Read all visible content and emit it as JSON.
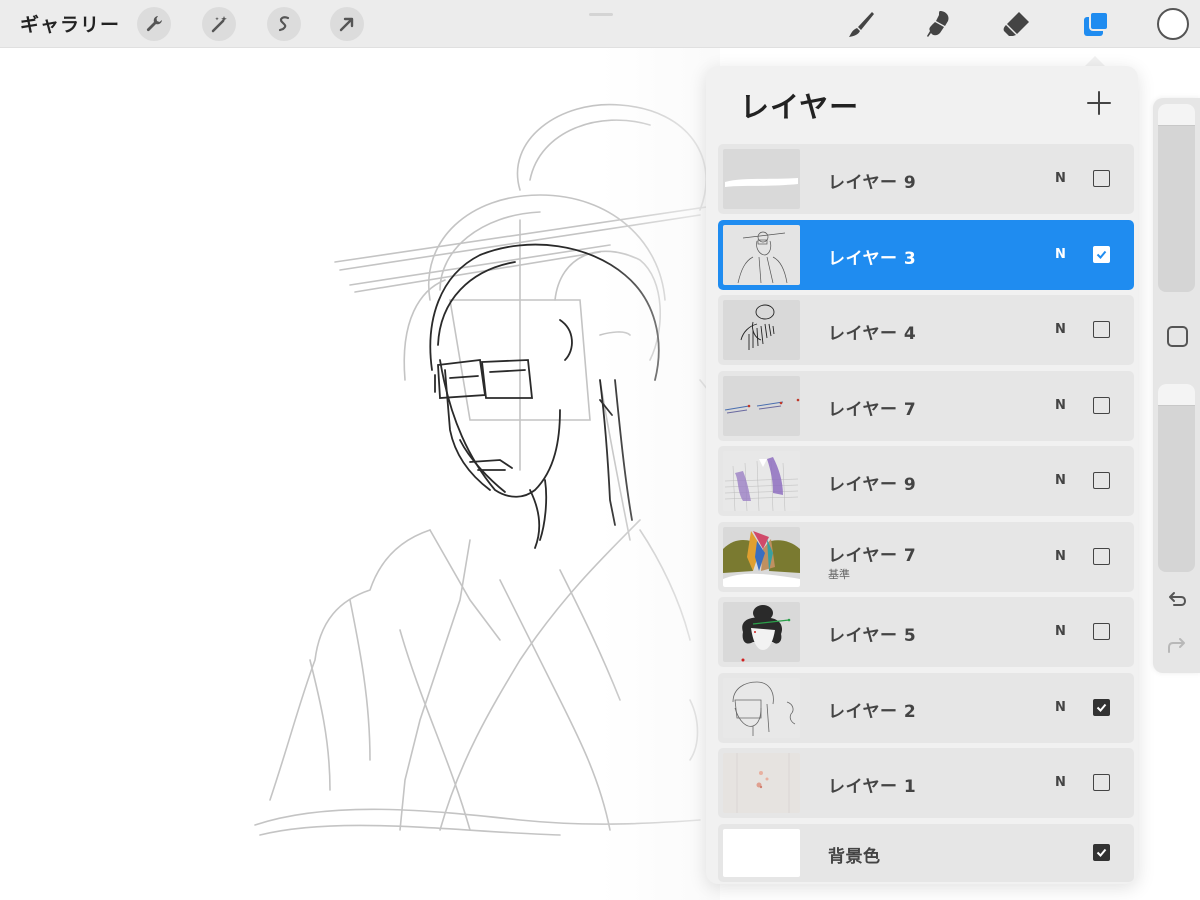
{
  "toolbar": {
    "gallery_label": "ギャラリー",
    "left_tools": [
      {
        "icon": "wrench-icon"
      },
      {
        "icon": "magic-wand-icon"
      },
      {
        "icon": "selection-icon"
      },
      {
        "icon": "transform-arrow-icon"
      }
    ],
    "right_tools": [
      {
        "icon": "brush-icon"
      },
      {
        "icon": "smudge-icon"
      },
      {
        "icon": "eraser-icon"
      },
      {
        "icon": "layers-icon",
        "active": true
      }
    ],
    "color_swatch": "#ffffff",
    "accent": "#1f8cf0"
  },
  "layers_panel": {
    "title": "レイヤー",
    "add_icon": "plus-icon",
    "layers": [
      {
        "name": "レイヤー 9",
        "blend": "N",
        "visible": false,
        "active": false,
        "thumb": "white-stroke"
      },
      {
        "name": "レイヤー 3",
        "blend": "N",
        "visible": true,
        "active": true,
        "thumb": "figure-sketch"
      },
      {
        "name": "レイヤー 4",
        "blend": "N",
        "visible": false,
        "active": false,
        "thumb": "hair-lineart"
      },
      {
        "name": "レイヤー 7",
        "blend": "N",
        "visible": false,
        "active": false,
        "thumb": "hairpins-color"
      },
      {
        "name": "レイヤー 9",
        "blend": "N",
        "visible": false,
        "active": false,
        "thumb": "purple-fabric"
      },
      {
        "name": "レイヤー 7",
        "sub": "基準",
        "blend": "N",
        "visible": false,
        "active": false,
        "thumb": "kimono-colors"
      },
      {
        "name": "レイヤー 5",
        "blend": "N",
        "visible": false,
        "active": false,
        "thumb": "face-hair-color"
      },
      {
        "name": "レイヤー 2",
        "blend": "N",
        "visible": true,
        "active": false,
        "thumb": "rough-sketch"
      },
      {
        "name": "レイヤー 1",
        "blend": "N",
        "visible": false,
        "active": false,
        "thumb": "paper-texture"
      }
    ],
    "background": {
      "name": "背景色",
      "visible": true,
      "color": "#ffffff"
    }
  },
  "sidebar": {
    "undo_icon": "undo-icon",
    "redo_icon": "redo-icon",
    "modifier_icon": "modifier-square-icon"
  }
}
